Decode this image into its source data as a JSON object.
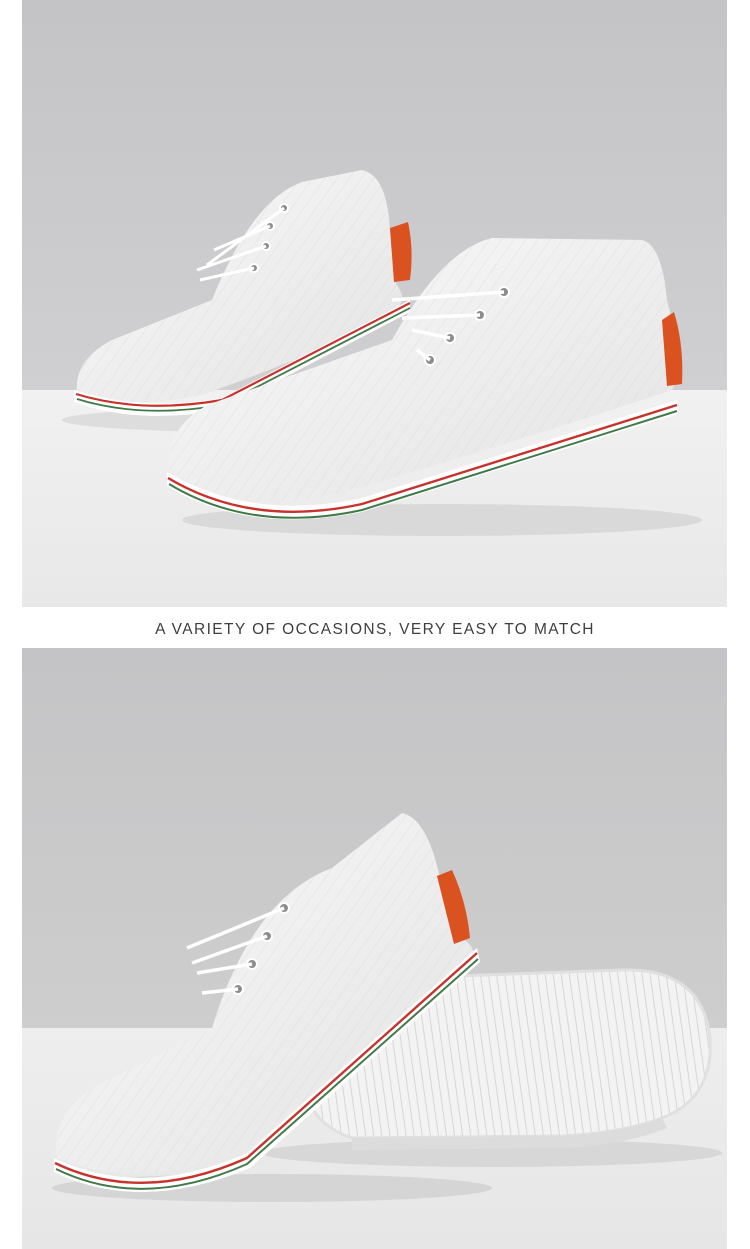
{
  "caption": "A VARIETY OF OCCASIONS, VERY EASY TO MATCH",
  "photos": [
    {
      "subject": "pair of white canvas lace-up sneakers"
    },
    {
      "subject": "white canvas sneaker with ribbed outsole shown"
    }
  ],
  "colors": {
    "wall": "#c9c9cb",
    "floor": "#ededed",
    "heel_tab": "#d9521f",
    "stripe_red": "#c8322c",
    "stripe_green": "#3f7a48"
  }
}
